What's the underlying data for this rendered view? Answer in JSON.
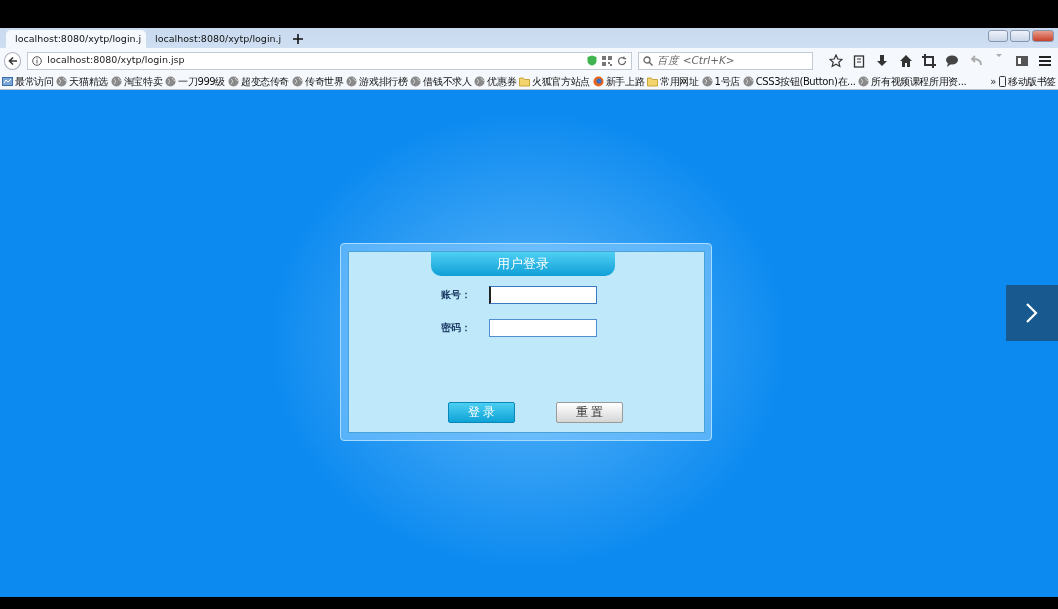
{
  "tabs": [
    {
      "title": "localhost:8080/xytp/login.j",
      "selected": true
    },
    {
      "title": "localhost:8080/xytp/login.j",
      "selected": false
    }
  ],
  "address": {
    "url": "localhost:8080/xytp/login.jsp"
  },
  "search": {
    "placeholder": "百度 <Ctrl+K>"
  },
  "bookmarks": [
    {
      "kind": "recent",
      "label": "最常访问"
    },
    {
      "kind": "globe",
      "label": "天猫精选"
    },
    {
      "kind": "globe",
      "label": "淘宝特卖"
    },
    {
      "kind": "globe",
      "label": "一刀999级"
    },
    {
      "kind": "globe",
      "label": "超变态传奇"
    },
    {
      "kind": "globe",
      "label": "传奇世界"
    },
    {
      "kind": "globe",
      "label": "游戏排行榜"
    },
    {
      "kind": "globe",
      "label": "借钱不求人"
    },
    {
      "kind": "globe",
      "label": "优惠券"
    },
    {
      "kind": "folder",
      "label": "火狐官方站点"
    },
    {
      "kind": "firefox",
      "label": "新手上路"
    },
    {
      "kind": "folder",
      "label": "常用网址"
    },
    {
      "kind": "globe",
      "label": "1号店"
    },
    {
      "kind": "globe",
      "label": "CSS3按钮(Button)在..."
    },
    {
      "kind": "globe",
      "label": "所有视频课程所用资..."
    }
  ],
  "bookmarks_overflow": "»",
  "mobile_bookmarks": "移动版书签",
  "login": {
    "title": "用户登录",
    "fields": [
      {
        "label": "账号：",
        "focused": true
      },
      {
        "label": "密码：",
        "focused": false
      }
    ],
    "buttons": [
      {
        "label": "登 录",
        "kind": "primary"
      },
      {
        "label": "重 置",
        "kind": "secondary"
      }
    ]
  }
}
